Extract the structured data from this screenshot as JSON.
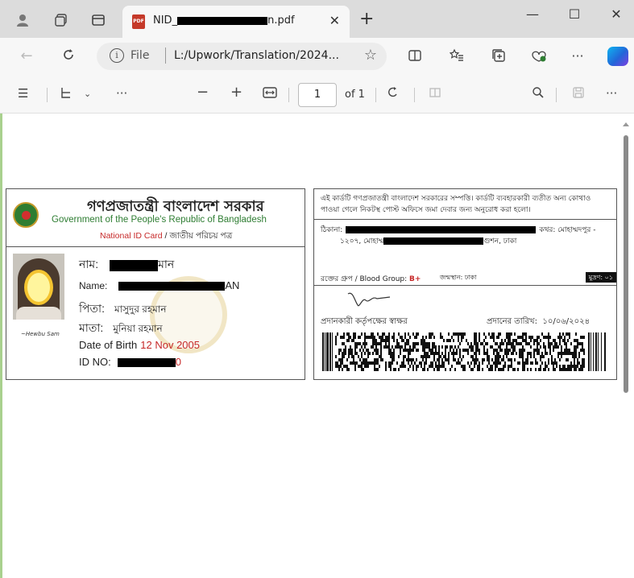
{
  "browser": {
    "tab": {
      "title_prefix": "NID_",
      "title_suffix": "n.pdf",
      "file_badge": "PDF"
    },
    "address": {
      "scheme_label": "File",
      "url": "L:/Upwork/Translation/2024..."
    }
  },
  "pdf_toolbar": {
    "page_number": "1",
    "page_total": "of 1"
  },
  "nid_front": {
    "bn_title": "গণপ্রজাতন্ত্রী বাংলাদেশ সরকার",
    "en_title": "Government of the People's Republic of Bangladesh",
    "card_type_en": "National ID Card",
    "card_type_sep": " / ",
    "card_type_bn": "জাতীয় পরিচয় পত্র",
    "name_bn_label": "নাম:",
    "name_bn_tail": "মান",
    "name_en_label": "Name:",
    "name_en_tail": "AN",
    "father_label": "পিতা:",
    "father_value": "মাসুদুর রহমান",
    "mother_label": "মাতা:",
    "mother_value": "মুনিয়া রহমান",
    "dob_label": "Date of Birth",
    "dob_value": "12 Nov 2005",
    "id_label": "ID NO:",
    "id_tail": "0"
  },
  "nid_back": {
    "notice": "এই কার্ডটি গণপ্রজাতন্ত্রী বাংলাদেশ সরকারের সম্পত্তি। কার্ডটি ব্যবহারকারী ব্যতীত অন্য কোথাও পাওয়া গেলে নিকটস্থ পোস্ট অফিসে জমা দেবার জন্য অনুরোধ করা হলো।",
    "address_label": "ঠিকানা:",
    "address_tail_line1": "কথর: মোহাম্মদপুর -",
    "address_line2_prefix": "১২০৭, মোহাম্ম",
    "address_line2_suffix": "গুশন, ঢাকা",
    "blood_group_label": "রক্তের গ্রুপ / Blood Group:",
    "blood_group_value": "B+",
    "birth_place": "জন্মস্থান: ঢাকা",
    "serial": "মুদ্রণ: ০১",
    "authority_label": "প্রদানকারী কর্তৃপক্ষের স্বাক্ষর",
    "issue_date_label": "প্রদানের তারিখ:",
    "issue_date_value": "১০/০৬/২০২৪"
  }
}
